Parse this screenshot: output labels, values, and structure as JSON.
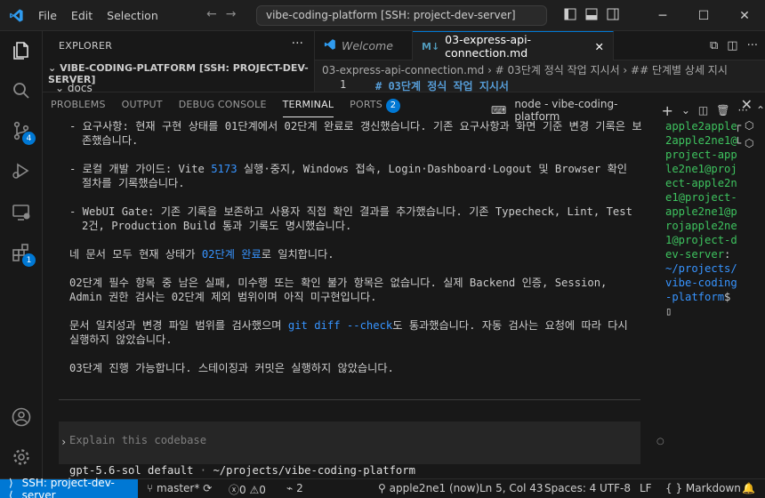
{
  "titlebar": {
    "menu": [
      "File",
      "Edit",
      "Selection"
    ],
    "command_center": "vibe-coding-platform [SSH: project-dev-server]"
  },
  "activity": {
    "scm_badge": "4",
    "extensions_badge": "1"
  },
  "sidebar": {
    "title": "EXPLORER",
    "project": "VIBE-CODING-PLATFORM [SSH: PROJECT-DEV-SERVER]",
    "folder": "docs"
  },
  "editor": {
    "tabs": [
      {
        "label": "Welcome"
      },
      {
        "label": "03-express-api-connection.md"
      }
    ],
    "breadcrumb": "03-express-api-connection.md › # 03단계 정식 작업 지시서 › ## 단계별 상세 지시",
    "line_number": "1",
    "line_text": "# 03단계 정식 작업 지시서"
  },
  "panel": {
    "tabs": [
      "PROBLEMS",
      "OUTPUT",
      "DEBUG CONSOLE",
      "TERMINAL",
      "PORTS"
    ],
    "ports_count": "2",
    "terminal_name": "node - vibe-coding-platform"
  },
  "terminal": {
    "b1": "- 요구사항: 현재 구현 상태를 01단계에서 02단계 완료로 갱신했습니다. 기존 요구사항과 화면 기준 변경 기록은 보존했습니다.",
    "b2a": "- 로컬 개발 가이드: Vite ",
    "b2port": "5173",
    "b2b": " 실행·중지, Windows 접속, Login·Dashboard·Logout 및 Browser 확인 절차를 기록했습니다.",
    "b3": "- WebUI Gate: 기존 기록을 보존하고 사용자 직접 확인 결과를 추가했습니다. 기존 Typecheck, Lint, Test 2건, Production Build 통과 기록도 명시했습니다.",
    "p1a": "네 문서 모두 현재 상태가 ",
    "p1hl": "02단계 완료",
    "p1b": "로 일치합니다.",
    "p2": "02단계 필수 항목 중 남은 실패, 미수행 또는 확인 불가 항목은 없습니다. 실제 Backend 인증, Session, Admin 권한 검사는 02단계 제외 범위이며 아직 미구현입니다.",
    "p3a": "문서 일치성과 변경 파일 범위를 검사했으며 ",
    "p3hl": "git diff --check",
    "p3b": "도 통과했습니다. 자동 검사는 요청에 따라 다시 실행하지 않았습니다.",
    "p4": "03단계 진행 가능합니다. 스테이징과 커밋은 실행하지 않았습니다.",
    "input_placeholder": "Explain this codebase",
    "model": "gpt-5.6-sol default",
    "path": "~/projects/vibe-coding-platform"
  },
  "split_terminal": {
    "green": "apple2apple2apple2ne1@project-apple2ne1@project-apple2ne1@project-apple2ne1@projapple2ne1@project-dev-server",
    "colon": ":",
    "path": "~/projects/vibe-coding-platform",
    "prompt": "$"
  },
  "statusbar": {
    "remote": "SSH: project-dev-server",
    "branch": "master*",
    "errors": "0",
    "warnings": "0",
    "ports": "2",
    "live_share": "apple2ne1 (now)",
    "position": "Ln 5, Col 43",
    "spaces": "Spaces: 4",
    "encoding": "UTF-8",
    "eol": "LF",
    "language": "Markdown"
  },
  "colors": {
    "accent": "#0078d4",
    "link": "#3794ff",
    "prompt_green": "#3ec35f"
  }
}
